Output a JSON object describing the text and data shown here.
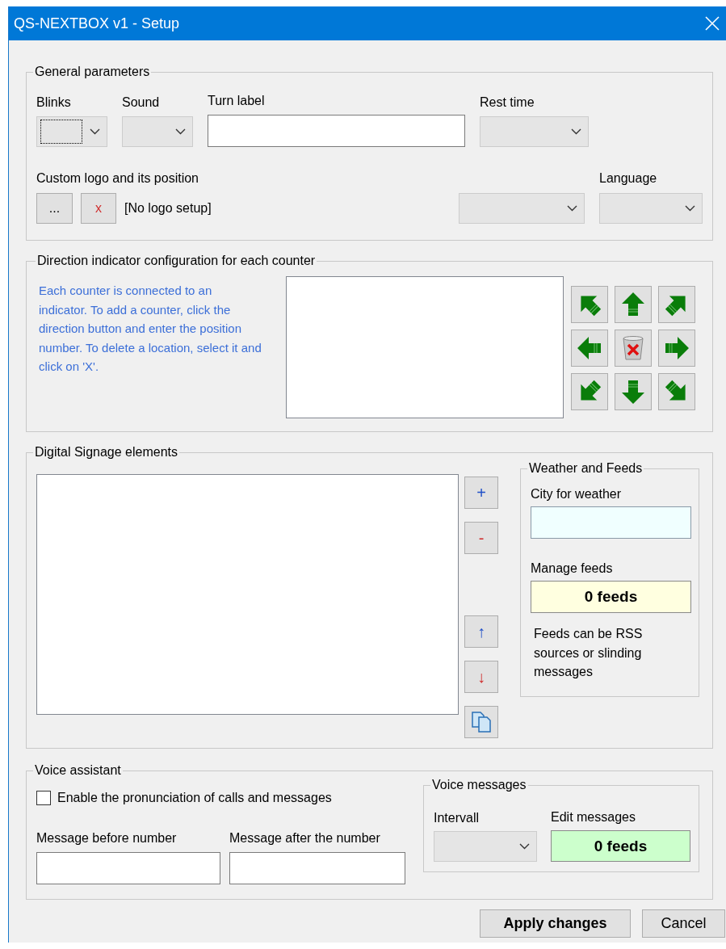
{
  "window": {
    "title": "QS-NEXTBOX v1 - Setup"
  },
  "general": {
    "legend": "General parameters",
    "row1": [
      {
        "kind": "combo",
        "label": "Blinks",
        "focused": true
      },
      {
        "kind": "combo",
        "label": "Sound",
        "focused": false
      },
      {
        "kind": "text",
        "label": "Turn label"
      },
      {
        "kind": "combo",
        "label": "Rest time",
        "focused": false
      }
    ],
    "logo_label": "Custom logo and its position",
    "browse_button": "...",
    "clear_button": "x",
    "logo_status": "[No logo setup]",
    "language_label": "Language"
  },
  "direction": {
    "legend": "Direction indicator configuration for each counter",
    "help": "Each counter is connected to an indicator. To add a counter, click the direction button and enter the position number. To delete a location, select it and click on 'X'.",
    "buttons": [
      {
        "kind": "northwest"
      },
      {
        "kind": "north"
      },
      {
        "kind": "northeast"
      },
      {
        "kind": "west"
      },
      {
        "kind": "delete"
      },
      {
        "kind": "east"
      },
      {
        "kind": "southwest"
      },
      {
        "kind": "south"
      },
      {
        "kind": "southeast"
      }
    ]
  },
  "signage": {
    "legend": "Digital Signage elements",
    "buttons": [
      {
        "kind": "add",
        "label": "+"
      },
      {
        "kind": "remove",
        "label": "-"
      },
      {
        "kind": "up",
        "label": "↑"
      },
      {
        "kind": "down",
        "label": "↓"
      },
      {
        "kind": "copy"
      }
    ],
    "weather": {
      "legend": "Weather and Feeds",
      "city_label": "City for weather",
      "feeds_label": "Manage feeds",
      "feeds_button": "0 feeds",
      "note": "Feeds can be RSS sources or slinding messages"
    }
  },
  "voice": {
    "legend": "Voice assistant",
    "enable": {
      "label": "Enable the pronunciation of calls and messages",
      "checked": false
    },
    "before_label": "Message before number",
    "after_label": "Message after the number",
    "messages": {
      "legend": "Voice messages",
      "interval_label": "Intervall",
      "edit_label": "Edit messages",
      "edit_button": "0 feeds"
    }
  },
  "footer": {
    "apply": "Apply changes",
    "cancel": "Cancel"
  }
}
